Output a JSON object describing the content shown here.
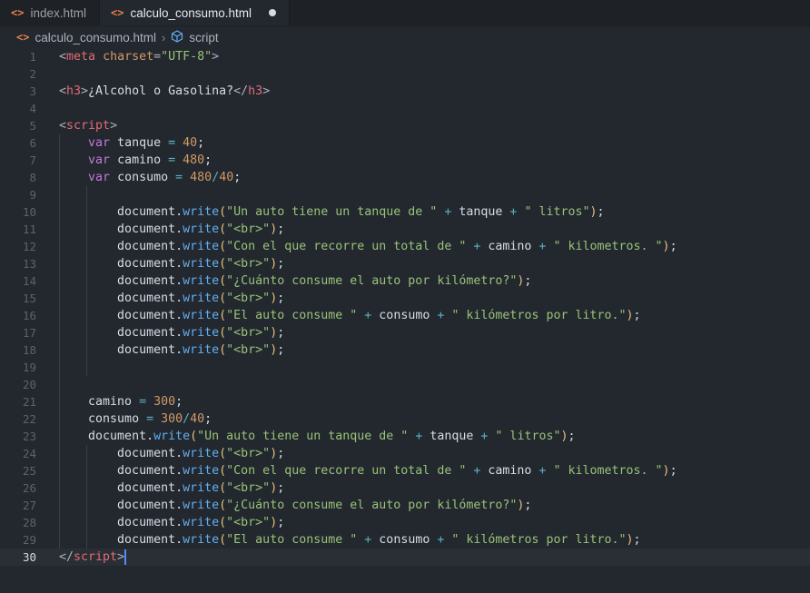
{
  "tabs": [
    {
      "label": "index.html",
      "icon": "html-brackets-icon",
      "active": false
    },
    {
      "label": "calculo_consumo.html",
      "icon": "html-brackets-icon",
      "active": true,
      "unsaved": true
    }
  ],
  "breadcrumb": {
    "file": "calculo_consumo.html",
    "symbol": "script"
  },
  "colors": {
    "background": "#23272e",
    "keyword": "#c678dd",
    "tag": "#e06c75",
    "string": "#98c379",
    "number": "#d19a66",
    "function": "#61afef",
    "operator": "#56b6c2",
    "cursor": "#528bff"
  },
  "editor": {
    "current_line": 30,
    "lines": [
      {
        "n": "1",
        "indent": 0,
        "tokens": [
          [
            "punc",
            "<"
          ],
          [
            "tag",
            "meta"
          ],
          [
            "plain",
            " "
          ],
          [
            "attr",
            "charset"
          ],
          [
            "punc",
            "="
          ],
          [
            "str",
            "\"UTF-8\""
          ],
          [
            "punc",
            ">"
          ]
        ]
      },
      {
        "n": "2",
        "indent": 0,
        "tokens": []
      },
      {
        "n": "3",
        "indent": 0,
        "tokens": [
          [
            "punc",
            "<"
          ],
          [
            "tag",
            "h3"
          ],
          [
            "punc",
            ">"
          ],
          [
            "plain",
            "¿Alcohol o Gasolina?"
          ],
          [
            "punc",
            "</"
          ],
          [
            "tag",
            "h3"
          ],
          [
            "punc",
            ">"
          ]
        ]
      },
      {
        "n": "4",
        "indent": 0,
        "tokens": []
      },
      {
        "n": "5",
        "indent": 0,
        "tokens": [
          [
            "punc",
            "<"
          ],
          [
            "tag",
            "script"
          ],
          [
            "punc",
            ">"
          ]
        ]
      },
      {
        "n": "6",
        "indent": 1,
        "tokens": [
          [
            "kw",
            "var"
          ],
          [
            "plain",
            " tanque "
          ],
          [
            "op",
            "="
          ],
          [
            "plain",
            " "
          ],
          [
            "num",
            "40"
          ],
          [
            "plain",
            ";"
          ]
        ]
      },
      {
        "n": "7",
        "indent": 1,
        "tokens": [
          [
            "kw",
            "var"
          ],
          [
            "plain",
            " camino "
          ],
          [
            "op",
            "="
          ],
          [
            "plain",
            " "
          ],
          [
            "num",
            "480"
          ],
          [
            "plain",
            ";"
          ]
        ]
      },
      {
        "n": "8",
        "indent": 1,
        "tokens": [
          [
            "kw",
            "var"
          ],
          [
            "plain",
            " consumo "
          ],
          [
            "op",
            "="
          ],
          [
            "plain",
            " "
          ],
          [
            "num",
            "480"
          ],
          [
            "op",
            "/"
          ],
          [
            "num",
            "40"
          ],
          [
            "plain",
            ";"
          ]
        ]
      },
      {
        "n": "9",
        "indent": 2,
        "tokens": []
      },
      {
        "n": "10",
        "indent": 2,
        "tokens": [
          [
            "plain",
            "document."
          ],
          [
            "fn",
            "write"
          ],
          [
            "brace",
            "("
          ],
          [
            "str",
            "\"Un auto tiene un tanque de \""
          ],
          [
            "plain",
            " "
          ],
          [
            "op",
            "+"
          ],
          [
            "plain",
            " tanque "
          ],
          [
            "op",
            "+"
          ],
          [
            "plain",
            " "
          ],
          [
            "str",
            "\" litros\""
          ],
          [
            "brace",
            ")"
          ],
          [
            "plain",
            ";"
          ]
        ]
      },
      {
        "n": "11",
        "indent": 2,
        "tokens": [
          [
            "plain",
            "document."
          ],
          [
            "fn",
            "write"
          ],
          [
            "brace",
            "("
          ],
          [
            "str",
            "\"<br>\""
          ],
          [
            "brace",
            ")"
          ],
          [
            "plain",
            ";"
          ]
        ]
      },
      {
        "n": "12",
        "indent": 2,
        "tokens": [
          [
            "plain",
            "document."
          ],
          [
            "fn",
            "write"
          ],
          [
            "brace",
            "("
          ],
          [
            "str",
            "\"Con el que recorre un total de \""
          ],
          [
            "plain",
            " "
          ],
          [
            "op",
            "+"
          ],
          [
            "plain",
            " camino "
          ],
          [
            "op",
            "+"
          ],
          [
            "plain",
            " "
          ],
          [
            "str",
            "\" kilometros. \""
          ],
          [
            "brace",
            ")"
          ],
          [
            "plain",
            ";"
          ]
        ]
      },
      {
        "n": "13",
        "indent": 2,
        "tokens": [
          [
            "plain",
            "document."
          ],
          [
            "fn",
            "write"
          ],
          [
            "brace",
            "("
          ],
          [
            "str",
            "\"<br>\""
          ],
          [
            "brace",
            ")"
          ],
          [
            "plain",
            ";"
          ]
        ]
      },
      {
        "n": "14",
        "indent": 2,
        "tokens": [
          [
            "plain",
            "document."
          ],
          [
            "fn",
            "write"
          ],
          [
            "brace",
            "("
          ],
          [
            "str",
            "\"¿Cuánto consume el auto por kilómetro?\""
          ],
          [
            "brace",
            ")"
          ],
          [
            "plain",
            ";"
          ]
        ]
      },
      {
        "n": "15",
        "indent": 2,
        "tokens": [
          [
            "plain",
            "document."
          ],
          [
            "fn",
            "write"
          ],
          [
            "brace",
            "("
          ],
          [
            "str",
            "\"<br>\""
          ],
          [
            "brace",
            ")"
          ],
          [
            "plain",
            ";"
          ]
        ]
      },
      {
        "n": "16",
        "indent": 2,
        "tokens": [
          [
            "plain",
            "document."
          ],
          [
            "fn",
            "write"
          ],
          [
            "brace",
            "("
          ],
          [
            "str",
            "\"El auto consume \""
          ],
          [
            "plain",
            " "
          ],
          [
            "op",
            "+"
          ],
          [
            "plain",
            " consumo "
          ],
          [
            "op",
            "+"
          ],
          [
            "plain",
            " "
          ],
          [
            "str",
            "\" kilómetros por litro.\""
          ],
          [
            "brace",
            ")"
          ],
          [
            "plain",
            ";"
          ]
        ]
      },
      {
        "n": "17",
        "indent": 2,
        "tokens": [
          [
            "plain",
            "document."
          ],
          [
            "fn",
            "write"
          ],
          [
            "brace",
            "("
          ],
          [
            "str",
            "\"<br>\""
          ],
          [
            "brace",
            ")"
          ],
          [
            "plain",
            ";"
          ]
        ]
      },
      {
        "n": "18",
        "indent": 2,
        "tokens": [
          [
            "plain",
            "document."
          ],
          [
            "fn",
            "write"
          ],
          [
            "brace",
            "("
          ],
          [
            "str",
            "\"<br>\""
          ],
          [
            "brace",
            ")"
          ],
          [
            "plain",
            ";"
          ]
        ]
      },
      {
        "n": "19",
        "indent": 2,
        "tokens": []
      },
      {
        "n": "20",
        "indent": 1,
        "tokens": []
      },
      {
        "n": "21",
        "indent": 1,
        "tokens": [
          [
            "plain",
            "camino "
          ],
          [
            "op",
            "="
          ],
          [
            "plain",
            " "
          ],
          [
            "num",
            "300"
          ],
          [
            "plain",
            ";"
          ]
        ]
      },
      {
        "n": "22",
        "indent": 1,
        "tokens": [
          [
            "plain",
            "consumo "
          ],
          [
            "op",
            "="
          ],
          [
            "plain",
            " "
          ],
          [
            "num",
            "300"
          ],
          [
            "op",
            "/"
          ],
          [
            "num",
            "40"
          ],
          [
            "plain",
            ";"
          ]
        ]
      },
      {
        "n": "23",
        "indent": 1,
        "tokens": [
          [
            "plain",
            "document."
          ],
          [
            "fn",
            "write"
          ],
          [
            "brace",
            "("
          ],
          [
            "str",
            "\"Un auto tiene un tanque de \""
          ],
          [
            "plain",
            " "
          ],
          [
            "op",
            "+"
          ],
          [
            "plain",
            " tanque "
          ],
          [
            "op",
            "+"
          ],
          [
            "plain",
            " "
          ],
          [
            "str",
            "\" litros\""
          ],
          [
            "brace",
            ")"
          ],
          [
            "plain",
            ";"
          ]
        ]
      },
      {
        "n": "24",
        "indent": 2,
        "tokens": [
          [
            "plain",
            "document."
          ],
          [
            "fn",
            "write"
          ],
          [
            "brace",
            "("
          ],
          [
            "str",
            "\"<br>\""
          ],
          [
            "brace",
            ")"
          ],
          [
            "plain",
            ";"
          ]
        ]
      },
      {
        "n": "25",
        "indent": 2,
        "tokens": [
          [
            "plain",
            "document."
          ],
          [
            "fn",
            "write"
          ],
          [
            "brace",
            "("
          ],
          [
            "str",
            "\"Con el que recorre un total de \""
          ],
          [
            "plain",
            " "
          ],
          [
            "op",
            "+"
          ],
          [
            "plain",
            " camino "
          ],
          [
            "op",
            "+"
          ],
          [
            "plain",
            " "
          ],
          [
            "str",
            "\" kilometros. \""
          ],
          [
            "brace",
            ")"
          ],
          [
            "plain",
            ";"
          ]
        ]
      },
      {
        "n": "26",
        "indent": 2,
        "tokens": [
          [
            "plain",
            "document."
          ],
          [
            "fn",
            "write"
          ],
          [
            "brace",
            "("
          ],
          [
            "str",
            "\"<br>\""
          ],
          [
            "brace",
            ")"
          ],
          [
            "plain",
            ";"
          ]
        ]
      },
      {
        "n": "27",
        "indent": 2,
        "tokens": [
          [
            "plain",
            "document."
          ],
          [
            "fn",
            "write"
          ],
          [
            "brace",
            "("
          ],
          [
            "str",
            "\"¿Cuánto consume el auto por kilómetro?\""
          ],
          [
            "brace",
            ")"
          ],
          [
            "plain",
            ";"
          ]
        ]
      },
      {
        "n": "28",
        "indent": 2,
        "tokens": [
          [
            "plain",
            "document."
          ],
          [
            "fn",
            "write"
          ],
          [
            "brace",
            "("
          ],
          [
            "str",
            "\"<br>\""
          ],
          [
            "brace",
            ")"
          ],
          [
            "plain",
            ";"
          ]
        ]
      },
      {
        "n": "29",
        "indent": 2,
        "tokens": [
          [
            "plain",
            "document."
          ],
          [
            "fn",
            "write"
          ],
          [
            "brace",
            "("
          ],
          [
            "str",
            "\"El auto consume \""
          ],
          [
            "plain",
            " "
          ],
          [
            "op",
            "+"
          ],
          [
            "plain",
            " consumo "
          ],
          [
            "op",
            "+"
          ],
          [
            "plain",
            " "
          ],
          [
            "str",
            "\" kilómetros por litro.\""
          ],
          [
            "brace",
            ")"
          ],
          [
            "plain",
            ";"
          ]
        ]
      },
      {
        "n": "30",
        "indent": 0,
        "tokens": [
          [
            "punc",
            "</"
          ],
          [
            "tag",
            "script"
          ],
          [
            "punc",
            ">"
          ]
        ]
      }
    ]
  }
}
